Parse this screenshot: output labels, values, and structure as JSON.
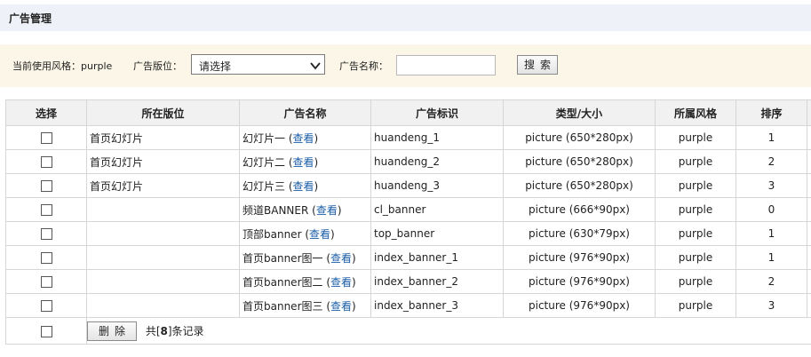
{
  "header": {
    "title": "广告管理"
  },
  "filter": {
    "style_label": "当前使用风格：",
    "style_value": "purple",
    "position_label": "广告版位：",
    "position_select": "请选择",
    "name_label": "广告名称：",
    "name_value": "",
    "search_button": "搜索"
  },
  "table": {
    "columns": [
      "选择",
      "所在版位",
      "广告名称",
      "广告标识",
      "类型/大小",
      "所属风格",
      "排序"
    ],
    "view_link": "查看",
    "rows": [
      {
        "position": "首页幻灯片",
        "name": "幻灯片一",
        "id": "huandeng_1",
        "type": "picture (650*280px)",
        "style": "purple",
        "order": "1"
      },
      {
        "position": "首页幻灯片",
        "name": "幻灯片二",
        "id": "huandeng_2",
        "type": "picture (650*280px)",
        "style": "purple",
        "order": "2"
      },
      {
        "position": "首页幻灯片",
        "name": "幻灯片三",
        "id": "huandeng_3",
        "type": "picture (650*280px)",
        "style": "purple",
        "order": "3"
      },
      {
        "position": "",
        "name": "频道BANNER",
        "id": "cl_banner",
        "type": "picture (666*90px)",
        "style": "purple",
        "order": "0"
      },
      {
        "position": "",
        "name": "顶部banner",
        "id": "top_banner",
        "type": "picture (630*79px)",
        "style": "purple",
        "order": "1"
      },
      {
        "position": "",
        "name": "首页banner图一",
        "id": "index_banner_1",
        "type": "picture (976*90px)",
        "style": "purple",
        "order": "1"
      },
      {
        "position": "",
        "name": "首页banner图二",
        "id": "index_banner_2",
        "type": "picture (976*90px)",
        "style": "purple",
        "order": "2"
      },
      {
        "position": "",
        "name": "首页banner图三",
        "id": "index_banner_3",
        "type": "picture (976*90px)",
        "style": "purple",
        "order": "3"
      }
    ]
  },
  "footer": {
    "delete_button": "删除",
    "count_prefix": "共[",
    "count_value": "8",
    "count_suffix": "]条记录"
  }
}
